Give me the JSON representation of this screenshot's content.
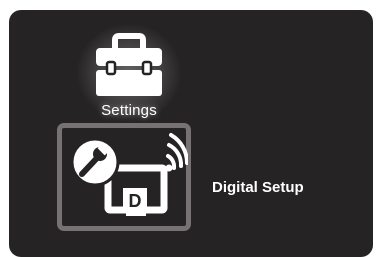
{
  "menu": {
    "items": [
      {
        "label": "Settings",
        "icon": "toolbox-icon",
        "state": "highlighted"
      },
      {
        "label": "Digital Setup",
        "icon": "digital-setup-icon",
        "state": "selected"
      }
    ]
  },
  "digital_icon": {
    "badge_letter": "D"
  },
  "colors": {
    "background": "#262324",
    "frame": "#767273",
    "icon": "#ffffff",
    "text": "#ffffff"
  }
}
